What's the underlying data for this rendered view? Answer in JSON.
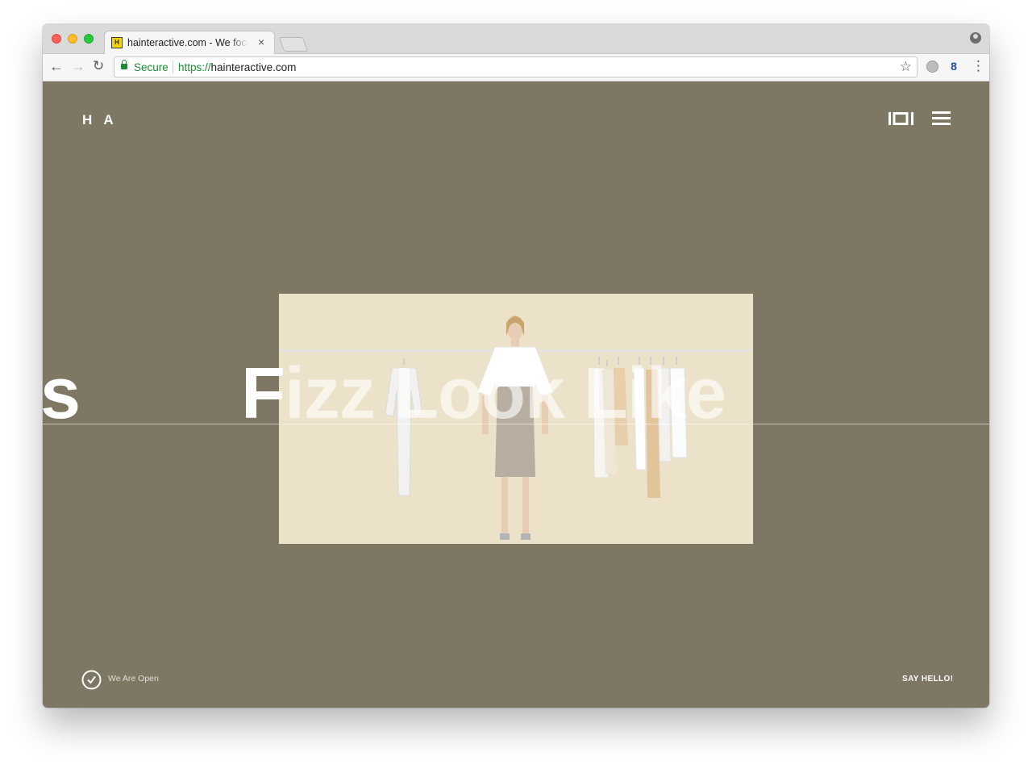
{
  "browser": {
    "tab": {
      "favicon_letter": "H",
      "title": "hainteractive.com - We focus on",
      "close_label": "×"
    },
    "nav": {
      "back": "←",
      "forward": "→",
      "reload": "↻"
    },
    "address_bar": {
      "secure_label": "Secure",
      "url_scheme": "https://",
      "url_host": "hainteractive.com",
      "bookmark": "☆"
    },
    "extensions": {
      "second_glyph": "8"
    },
    "menu_glyph": "⋮"
  },
  "site": {
    "logo": "H A",
    "header_icons": [
      "gallery-view-icon",
      "hamburger-menu-icon"
    ],
    "hero": {
      "left_fragment": "s",
      "main_prefix": "F",
      "main_rest": "izz Look Like"
    },
    "footer": {
      "status_icon": "clock-check-icon",
      "status_text": "We Are Open",
      "cta": "SAY HELLO!"
    },
    "colors": {
      "page_background": "#7e7763",
      "image_background": "#ece2c9",
      "text": "#ffffff"
    }
  }
}
